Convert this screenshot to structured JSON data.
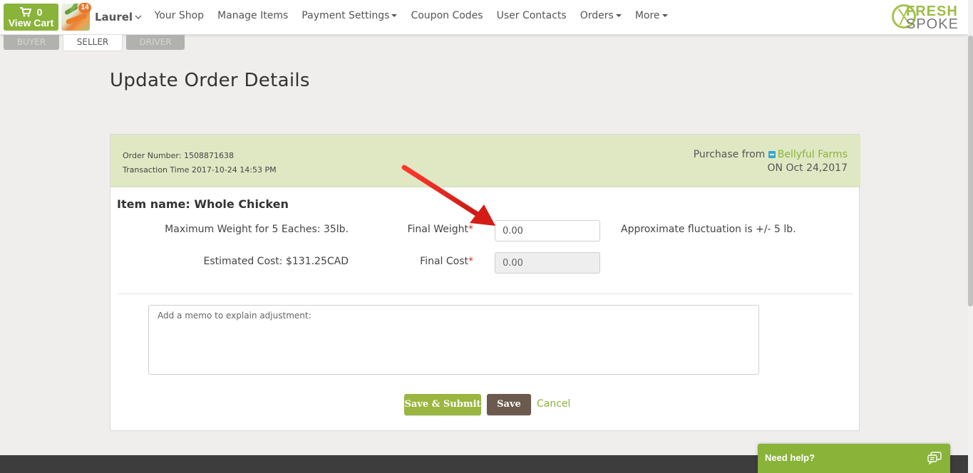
{
  "cart": {
    "count": "0",
    "label": "View Cart"
  },
  "user": {
    "badge": "14",
    "name": "Laurel"
  },
  "nav": {
    "items": [
      {
        "label": "Your Shop",
        "dropdown": false
      },
      {
        "label": "Manage Items",
        "dropdown": false
      },
      {
        "label": "Payment Settings",
        "dropdown": true
      },
      {
        "label": "Coupon Codes",
        "dropdown": false
      },
      {
        "label": "User Contacts",
        "dropdown": false
      },
      {
        "label": "Orders",
        "dropdown": true
      },
      {
        "label": "More",
        "dropdown": true
      }
    ]
  },
  "logo": {
    "line1": "FRESH",
    "line2": "SPOKE"
  },
  "roles": {
    "buyer": "BUYER",
    "seller": "SELLER",
    "driver": "DRIVER",
    "active": "SELLER"
  },
  "page": {
    "title": "Update Order Details"
  },
  "order": {
    "number": "Order Number: 1508871638",
    "transaction": "Transaction Time 2017-10-24 14:53 PM",
    "purchase_prefix": "Purchase from",
    "farm": "Bellyful Farms",
    "date": "ON Oct 24,2017"
  },
  "item": {
    "name": "Item name: Whole Chicken",
    "max_weight": "Maximum Weight for 5 Eaches: 35lb.",
    "estimated_cost": "Estimated Cost: $131.25CAD",
    "final_weight_label": "Final Weight",
    "final_weight_value": "0.00",
    "final_cost_label": "Final Cost",
    "final_cost_value": "0.00",
    "required_mark": "*",
    "fluctuation": "Approximate fluctuation is +/- 5 lb."
  },
  "memo": {
    "placeholder": "Add a memo to explain adjustment:"
  },
  "actions": {
    "submit": "Save & Submit",
    "save": "Save",
    "cancel": "Cancel"
  },
  "help": {
    "label": "Need help?"
  },
  "colors": {
    "brand_green": "#8ab33a",
    "header_green": "#dfe8c3",
    "save_brown": "#6b5a4d",
    "required_red": "#d0312d",
    "arrow_red": "#e0221c"
  },
  "icons": {
    "cart": "shopping-cart-icon",
    "store": "store-icon",
    "chat": "chat-bubbles-icon",
    "user_caret": "chevron-down-icon"
  }
}
